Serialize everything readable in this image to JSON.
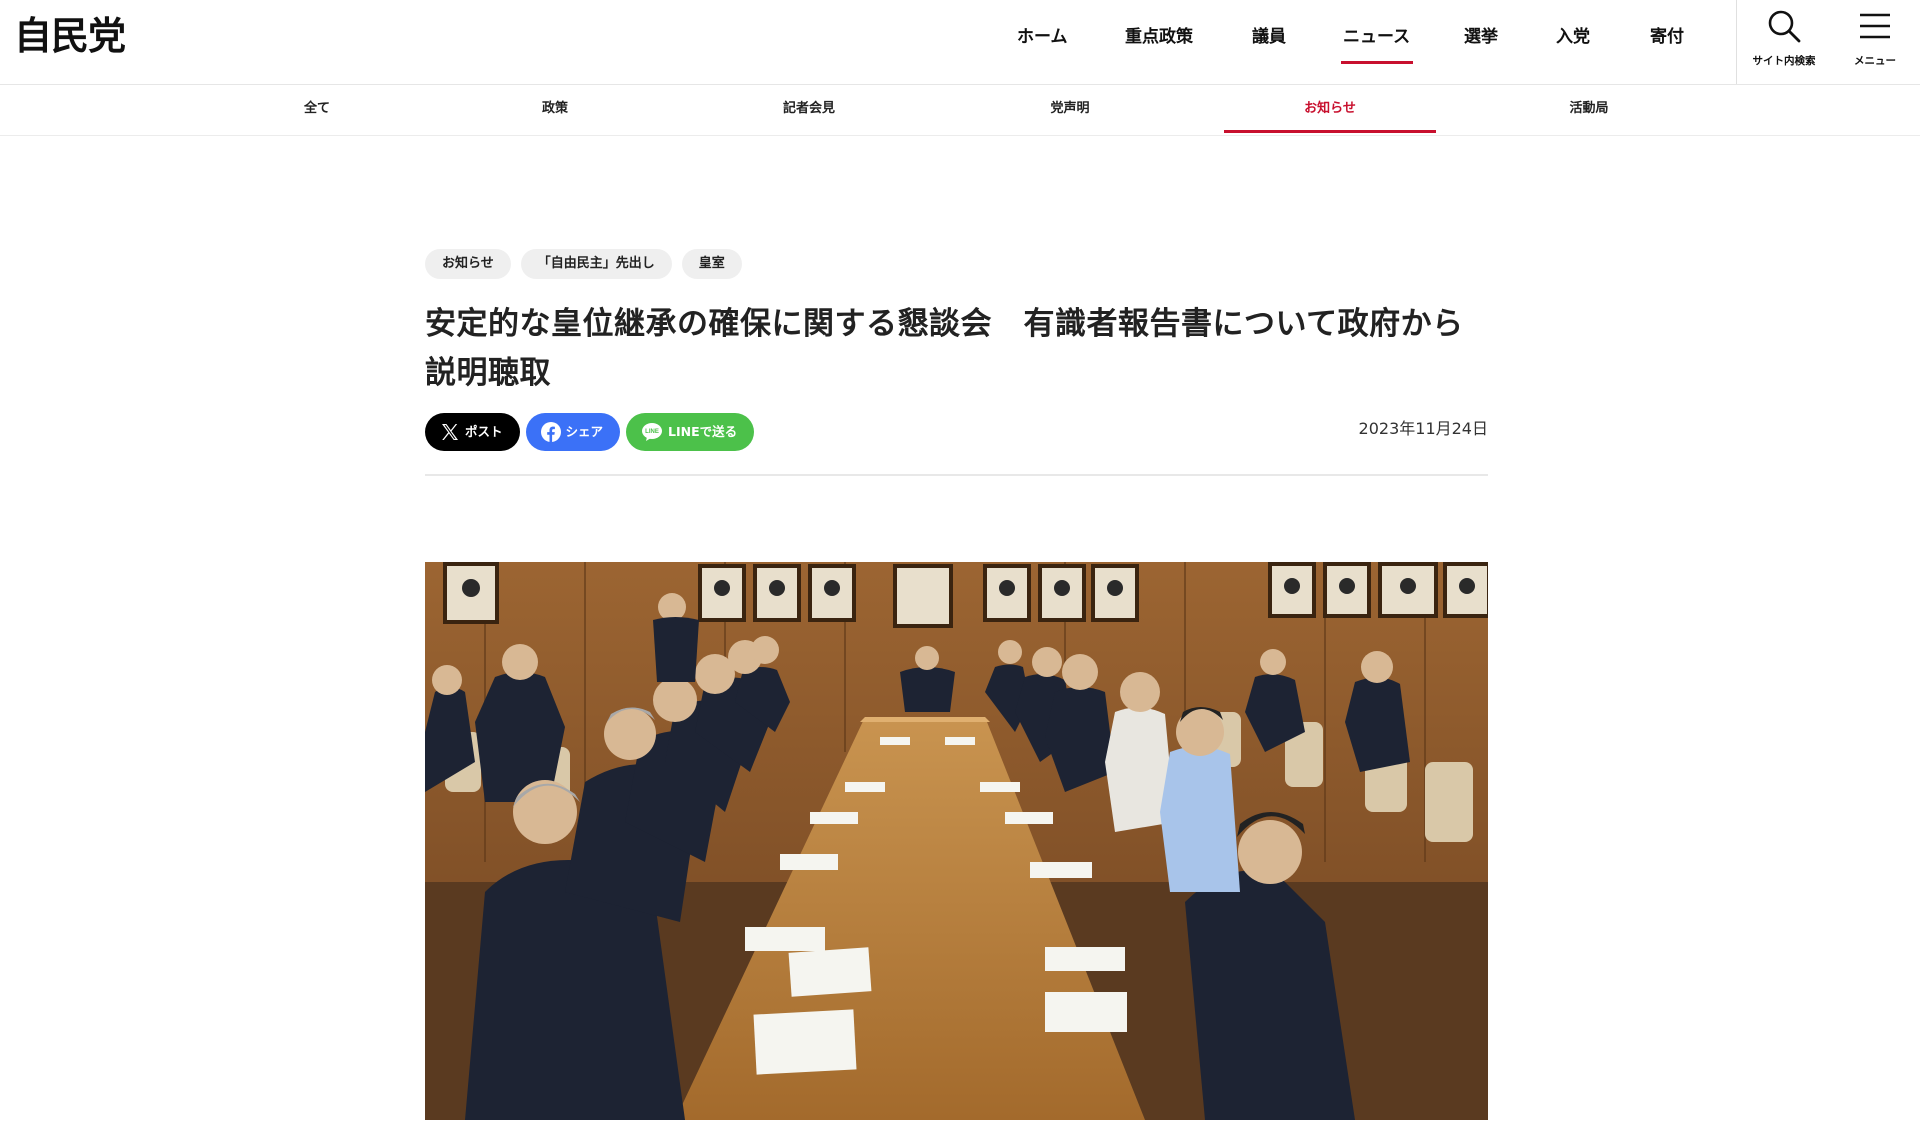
{
  "header": {
    "logo": "自民党",
    "nav": [
      {
        "label": "ホーム",
        "active": false
      },
      {
        "label": "重点政策",
        "active": false
      },
      {
        "label": "議員",
        "active": false
      },
      {
        "label": "ニュース",
        "active": true
      },
      {
        "label": "選挙",
        "active": false
      },
      {
        "label": "入党",
        "active": false
      },
      {
        "label": "寄付",
        "active": false
      }
    ],
    "search_label": "サイト内検索",
    "search_icon": "search-icon",
    "menu_label": "メニュー",
    "menu_icon": "hamburger-menu-icon"
  },
  "subnav": [
    {
      "label": "全て",
      "active": false
    },
    {
      "label": "政策",
      "active": false
    },
    {
      "label": "記者会見",
      "active": false
    },
    {
      "label": "党声明",
      "active": false
    },
    {
      "label": "お知らせ",
      "active": true
    },
    {
      "label": "活動局",
      "active": false
    }
  ],
  "article": {
    "tags": [
      "お知らせ",
      "「自由民主」先出し",
      "皇室"
    ],
    "title_line1": "安定的な皇位継承の確保に関する懇談会　有識者報告書について政府から",
    "title_line2": "説明聴取",
    "share": {
      "x_label": "ポスト",
      "x_icon": "x-logo-icon",
      "facebook_label": "シェア",
      "facebook_icon": "facebook-icon",
      "line_label": "LINEで送る",
      "line_icon": "line-icon",
      "line_icon_text": "LINE"
    },
    "date": "2023年11月24日",
    "photo_description_icon": "meeting-photo"
  },
  "colors": {
    "accent": "#c8102e",
    "x": "#000000",
    "facebook": "#3b71f7",
    "line": "#4cc14a",
    "tag_bg": "#efefef"
  }
}
